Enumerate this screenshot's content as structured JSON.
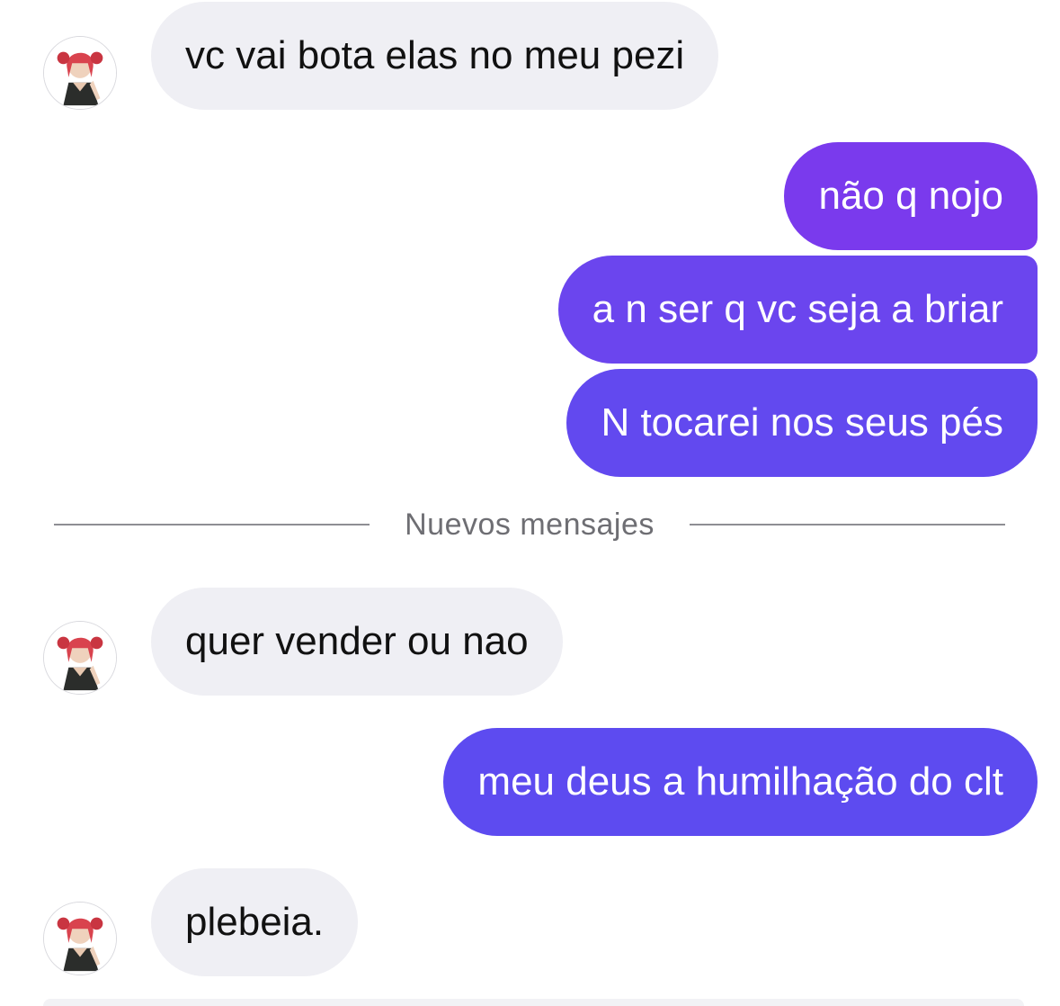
{
  "messages": [
    {
      "text": "vc vai bota elas no meu pezi",
      "direction": "incoming"
    },
    {
      "text": "não q nojo",
      "direction": "outgoing"
    },
    {
      "text": "a n ser q vc seja a briar",
      "direction": "outgoing"
    },
    {
      "text": "N tocarei nos seus pés",
      "direction": "outgoing"
    },
    {
      "text": "quer vender ou nao",
      "direction": "incoming"
    },
    {
      "text": "meu deus a humilhação do clt",
      "direction": "outgoing"
    },
    {
      "text": "plebeia.",
      "direction": "incoming"
    }
  ],
  "divider": {
    "label": "Nuevos mensajes"
  },
  "avatar": {
    "icon": "anime-girl-avatar-icon"
  },
  "colors": {
    "incoming_bubble": "#efeff4",
    "outgoing_top": "#7a3aed",
    "outgoing_mid": "#6b45ee",
    "outgoing_bottom": "#5d4bf0",
    "divider_text": "#6e6e73"
  }
}
